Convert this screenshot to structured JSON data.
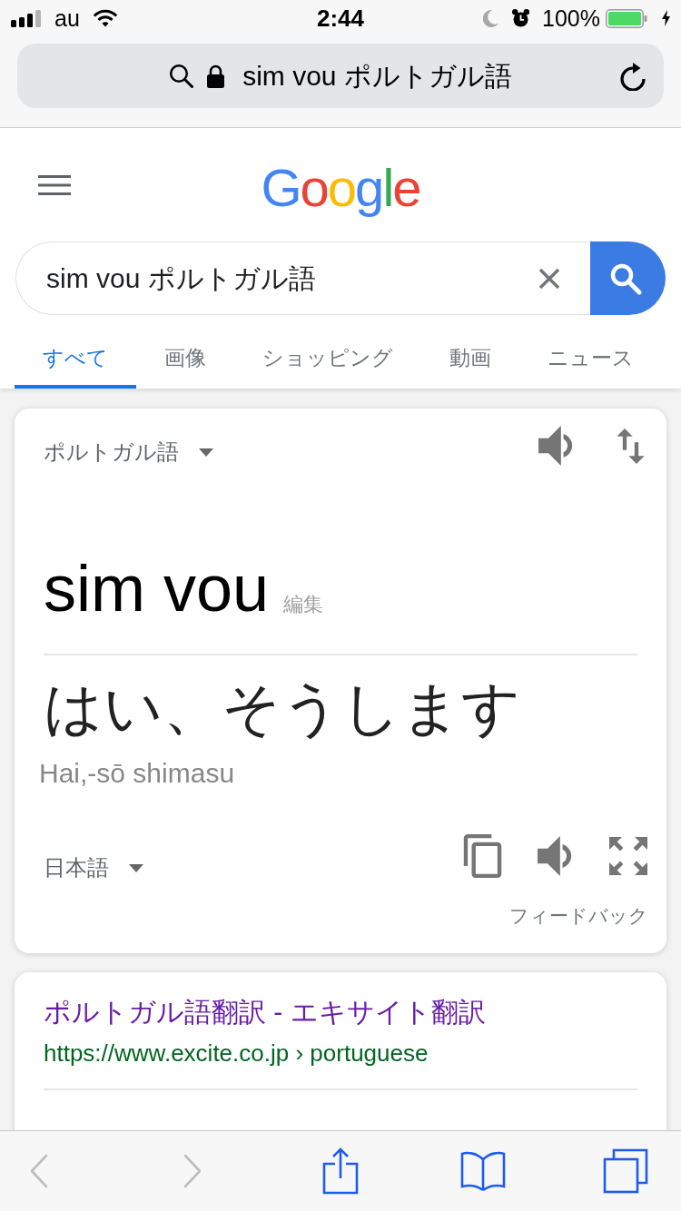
{
  "status_bar": {
    "carrier": "au",
    "time": "2:44",
    "battery": "100%"
  },
  "address_bar": {
    "url": "sim vou ポルトガル語"
  },
  "header": {
    "logo": "Google"
  },
  "search": {
    "query": "sim vou ポルトガル語"
  },
  "tabs": [
    {
      "label": "すべて",
      "selected": true
    },
    {
      "label": "画像",
      "selected": false
    },
    {
      "label": "ショッピング",
      "selected": false
    },
    {
      "label": "動画",
      "selected": false
    },
    {
      "label": "ニュース",
      "selected": false
    }
  ],
  "translate_card": {
    "source_language": "ポルトガル語",
    "source_text": "sim vou",
    "edit_label": "編集",
    "translation": "はい、そうします",
    "romanization": "Hai,-sō shimasu",
    "target_language": "日本語",
    "feedback": "フィードバック"
  },
  "result": {
    "title": "ポルトガル語翻訳 - エキサイト翻訳",
    "url": "https://www.excite.co.jp › portuguese"
  },
  "toolbar": [
    {
      "kind": "back",
      "disabled": true
    },
    {
      "kind": "forward",
      "disabled": true
    },
    {
      "kind": "share",
      "disabled": false
    },
    {
      "kind": "bookmarks",
      "disabled": false
    },
    {
      "kind": "tabs",
      "disabled": false
    }
  ]
}
